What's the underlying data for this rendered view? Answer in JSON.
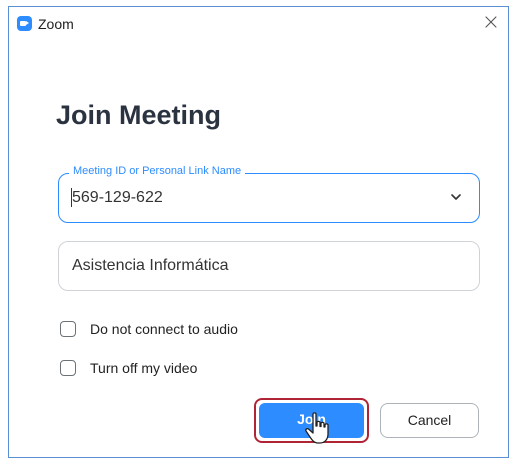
{
  "window": {
    "title": "Zoom",
    "close_glyph": "×"
  },
  "heading": "Join Meeting",
  "meeting_id_field": {
    "legend": "Meeting ID or Personal Link Name",
    "value": "569-129-622",
    "dropdown_icon": "chevron-down-icon"
  },
  "name_field": {
    "value": "Asistencia Informática"
  },
  "options": [
    {
      "label": "Do not connect to audio",
      "checked": false
    },
    {
      "label": "Turn off my video",
      "checked": false
    }
  ],
  "buttons": {
    "join": "Join",
    "cancel": "Cancel"
  },
  "colors": {
    "accent": "#2d8cff",
    "highlight_border": "#b02535"
  }
}
